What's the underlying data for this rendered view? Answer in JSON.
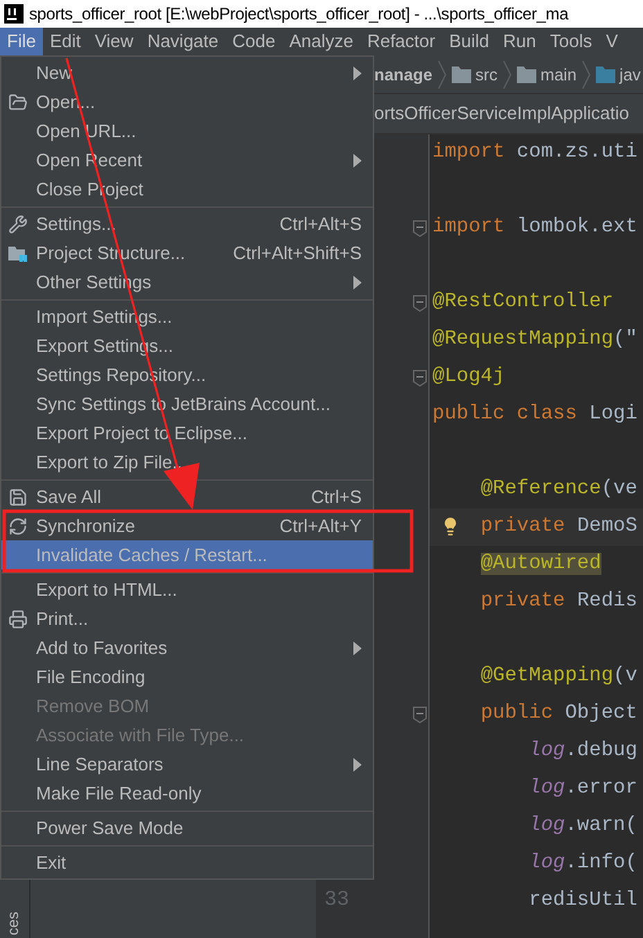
{
  "window": {
    "title": "sports_officer_root [E:\\webProject\\sports_officer_root] - ...\\sports_officer_ma"
  },
  "menubar": [
    {
      "label": "File",
      "selected": true
    },
    {
      "label": "Edit",
      "selected": false
    },
    {
      "label": "View",
      "selected": false
    },
    {
      "label": "Navigate",
      "selected": false
    },
    {
      "label": "Code",
      "selected": false
    },
    {
      "label": "Analyze",
      "selected": false
    },
    {
      "label": "Refactor",
      "selected": false
    },
    {
      "label": "Build",
      "selected": false
    },
    {
      "label": "Run",
      "selected": false
    },
    {
      "label": "Tools",
      "selected": false
    },
    {
      "label": "V",
      "selected": false
    }
  ],
  "file_menu": [
    {
      "kind": "item",
      "label": "New",
      "submenu": true
    },
    {
      "kind": "item",
      "label": "Open..."
    },
    {
      "kind": "item",
      "label": "Open URL..."
    },
    {
      "kind": "item",
      "label": "Open Recent",
      "submenu": true
    },
    {
      "kind": "item",
      "label": "Close Project"
    },
    {
      "kind": "separator"
    },
    {
      "kind": "item",
      "label": "Settings...",
      "shortcut": "Ctrl+Alt+S"
    },
    {
      "kind": "item",
      "label": "Project Structure...",
      "shortcut": "Ctrl+Alt+Shift+S"
    },
    {
      "kind": "item",
      "label": "Other Settings",
      "submenu": true
    },
    {
      "kind": "separator"
    },
    {
      "kind": "item",
      "label": "Import Settings..."
    },
    {
      "kind": "item",
      "label": "Export Settings..."
    },
    {
      "kind": "item",
      "label": "Settings Repository..."
    },
    {
      "kind": "item",
      "label": "Sync Settings to JetBrains Account..."
    },
    {
      "kind": "item",
      "label": "Export Project to Eclipse..."
    },
    {
      "kind": "item",
      "label": "Export to Zip File..."
    },
    {
      "kind": "separator"
    },
    {
      "kind": "item",
      "label": "Save All",
      "shortcut": "Ctrl+S"
    },
    {
      "kind": "item",
      "label": "Synchronize",
      "shortcut": "Ctrl+Alt+Y"
    },
    {
      "kind": "item",
      "label": "Invalidate Caches / Restart...",
      "selected": true
    },
    {
      "kind": "separator"
    },
    {
      "kind": "item",
      "label": "Export to HTML..."
    },
    {
      "kind": "item",
      "label": "Print..."
    },
    {
      "kind": "item",
      "label": "Add to Favorites",
      "submenu": true
    },
    {
      "kind": "item",
      "label": "File Encoding"
    },
    {
      "kind": "item",
      "label": "Remove BOM",
      "disabled": true
    },
    {
      "kind": "item",
      "label": "Associate with File Type...",
      "disabled": true
    },
    {
      "kind": "item",
      "label": "Line Separators",
      "submenu": true
    },
    {
      "kind": "item",
      "label": "Make File Read-only"
    },
    {
      "kind": "separator"
    },
    {
      "kind": "item",
      "label": "Power Save Mode"
    },
    {
      "kind": "separator"
    },
    {
      "kind": "item",
      "label": "Exit"
    }
  ],
  "breadcrumbs": [
    {
      "label": "nanage",
      "kind": "module"
    },
    {
      "label": "src",
      "kind": "folder"
    },
    {
      "label": "main",
      "kind": "folder"
    },
    {
      "label": "jav",
      "kind": "source-folder"
    }
  ],
  "editor_tab": {
    "label": "ortsOfficerServiceImplApplicatio"
  },
  "code_lines": [
    {
      "tokens": [
        {
          "text": "import ",
          "kind": "keyword"
        },
        {
          "text": "com.zs.uti",
          "kind": "plain"
        }
      ]
    },
    {
      "blank_line_before": true,
      "fold": true,
      "tokens": [
        {
          "text": "import ",
          "kind": "keyword"
        },
        {
          "text": "lombok.ext",
          "kind": "plain"
        }
      ]
    },
    {
      "blank_line_before": true,
      "fold": true,
      "tokens": [
        {
          "text": "@RestController",
          "kind": "annotation"
        }
      ]
    },
    {
      "tokens": [
        {
          "text": "@RequestMapping",
          "kind": "annotation"
        },
        {
          "text": "(\"",
          "kind": "plain"
        }
      ]
    },
    {
      "fold": true,
      "tokens": [
        {
          "text": "@Log4j",
          "kind": "annotation"
        }
      ]
    },
    {
      "tokens": [
        {
          "text": "public class ",
          "kind": "keyword"
        },
        {
          "text": "Logi",
          "kind": "plain"
        }
      ]
    },
    {
      "blank_line_before": true,
      "tokens": [
        {
          "text": "    @Reference",
          "kind": "annotation"
        },
        {
          "text": "(ve",
          "kind": "plain"
        }
      ]
    },
    {
      "current": true,
      "bulb": true,
      "tokens": [
        {
          "text": "    private ",
          "kind": "keyword"
        },
        {
          "text": "DemoS",
          "kind": "plain"
        }
      ]
    },
    {
      "tokens": [
        {
          "text": "    @Autowired",
          "kind": "marked"
        }
      ]
    },
    {
      "tokens": [
        {
          "text": "    private ",
          "kind": "keyword"
        },
        {
          "text": "Redis",
          "kind": "plain"
        }
      ]
    },
    {
      "blank_line_before": true,
      "tokens": [
        {
          "text": "    @GetMapping",
          "kind": "annotation"
        },
        {
          "text": "(v",
          "kind": "plain"
        }
      ]
    },
    {
      "fold": true,
      "tokens": [
        {
          "text": "    public ",
          "kind": "keyword"
        },
        {
          "text": "Object",
          "kind": "plain"
        }
      ]
    },
    {
      "tokens": [
        {
          "text": "        log",
          "kind": "field"
        },
        {
          "text": ".debug",
          "kind": "plain"
        }
      ]
    },
    {
      "tokens": [
        {
          "text": "        log",
          "kind": "field"
        },
        {
          "text": ".error",
          "kind": "plain"
        }
      ]
    },
    {
      "tokens": [
        {
          "text": "        log",
          "kind": "field"
        },
        {
          "text": ".warn(",
          "kind": "plain"
        }
      ]
    },
    {
      "tokens": [
        {
          "text": "        log",
          "kind": "field"
        },
        {
          "text": ".info(",
          "kind": "plain"
        }
      ]
    },
    {
      "tokens": [
        {
          "text": "        redisUtil",
          "kind": "plain"
        }
      ]
    }
  ],
  "line_number": "33",
  "side_tab": "ces",
  "annotations": {
    "arrow": true,
    "frame": true
  }
}
